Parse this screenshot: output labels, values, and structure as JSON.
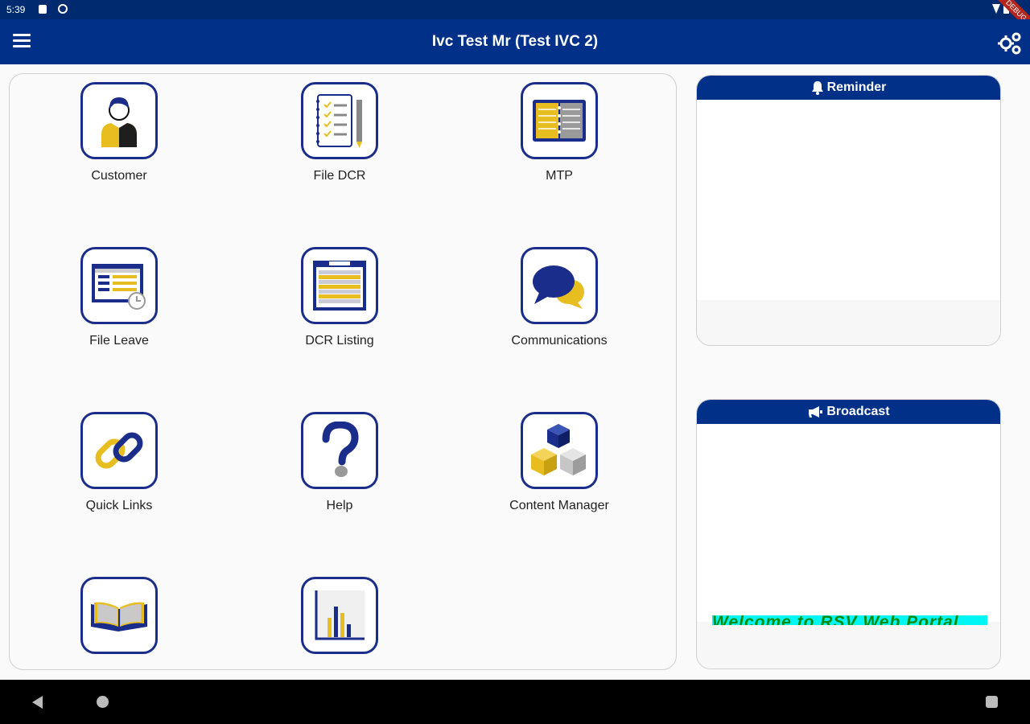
{
  "status_bar": {
    "time": "5:39",
    "debug_label": "DEBUG"
  },
  "app_bar": {
    "title": "Ivc Test Mr (Test IVC 2)",
    "menu_icon": "menu-icon",
    "settings_icon": "gears-icon"
  },
  "menu_tiles": [
    {
      "label": "Customer",
      "icon": "customer-icon"
    },
    {
      "label": "File DCR",
      "icon": "checklist-notebook-icon"
    },
    {
      "label": "MTP",
      "icon": "planner-book-icon"
    },
    {
      "label": "File Leave",
      "icon": "calendar-clock-icon"
    },
    {
      "label": "DCR Listing",
      "icon": "listing-icon"
    },
    {
      "label": "Communications",
      "icon": "chat-bubbles-icon"
    },
    {
      "label": "Quick Links",
      "icon": "link-icon"
    },
    {
      "label": "Help",
      "icon": "question-mark-icon"
    },
    {
      "label": "Content Manager",
      "icon": "cubes-icon"
    },
    {
      "label": "",
      "icon": "open-book-icon"
    },
    {
      "label": "",
      "icon": "bar-chart-icon"
    }
  ],
  "reminder_panel": {
    "title": "Reminder",
    "icon": "bell-icon"
  },
  "broadcast_panel": {
    "title": "Broadcast",
    "icon": "megaphone-icon",
    "message": "Welcome to RSV Web Portal"
  },
  "colors": {
    "primary": "#003087",
    "accent_yellow": "#e8bd1f",
    "tile_border": "#1a2d8a",
    "marquee_bg": "#00f5f5",
    "marquee_text": "#0a8a0a"
  }
}
